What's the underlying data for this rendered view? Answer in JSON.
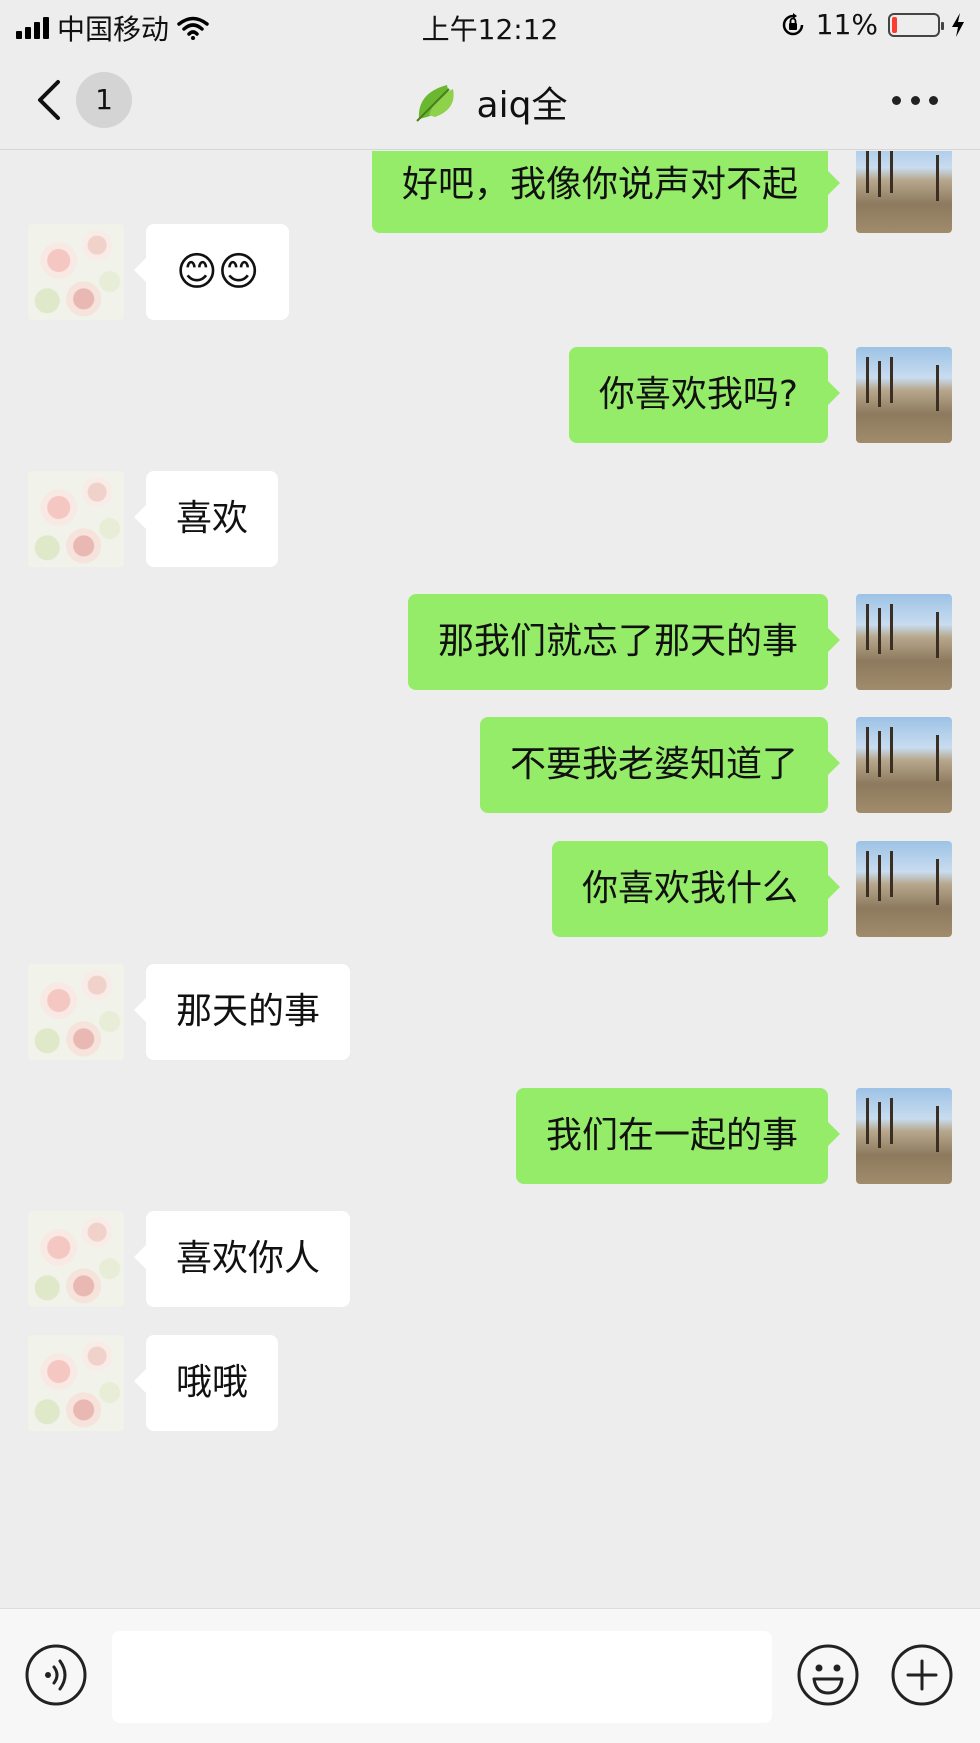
{
  "status_bar": {
    "carrier": "中国移动",
    "time": "上午12:12",
    "battery": "11%",
    "battery_level": 0.11,
    "icons": [
      "signal-icon",
      "wifi-icon",
      "orientation-lock-icon",
      "battery-icon",
      "charging-icon"
    ]
  },
  "nav": {
    "back_icon": "chevron-left-icon",
    "unread_count": "1",
    "title": "aiq全",
    "title_icon": "leaf-icon",
    "more_icon": "more-dots-icon"
  },
  "messages": [
    {
      "side": "out",
      "text": "好吧，我像你说声对不起"
    },
    {
      "side": "in",
      "text": "😊😊"
    },
    {
      "side": "out",
      "text": "你喜欢我吗?"
    },
    {
      "side": "in",
      "text": "喜欢"
    },
    {
      "side": "out",
      "text": "那我们就忘了那天的事"
    },
    {
      "side": "out",
      "text": "不要我老婆知道了"
    },
    {
      "side": "out",
      "text": "你喜欢我什么"
    },
    {
      "side": "in",
      "text": "那天的事"
    },
    {
      "side": "out",
      "text": "我们在一起的事"
    },
    {
      "side": "in",
      "text": "喜欢你人"
    },
    {
      "side": "in",
      "text": "哦哦"
    }
  ],
  "input_bar": {
    "voice_icon": "voice-icon",
    "text_value": "",
    "emoji_icon": "emoji-icon",
    "plus_icon": "plus-icon"
  },
  "colors": {
    "background": "#ededed",
    "outgoing_bubble": "#95ec69",
    "incoming_bubble": "#ffffff",
    "battery_low": "#ff3b30"
  }
}
